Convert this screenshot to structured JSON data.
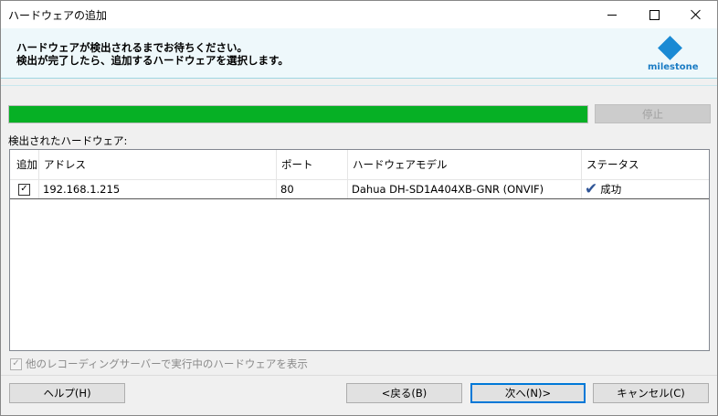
{
  "window": {
    "title": "ハードウェアの追加"
  },
  "header": {
    "line1": "ハードウェアが検出されるまでお待ちください。",
    "line2": "検出が完了したら、追加するハードウェアを選択します。",
    "logo_text": "milestone",
    "logo_color": "#1a8ad4"
  },
  "progress": {
    "percent": 100,
    "color": "#06b025",
    "stop_label": "停止"
  },
  "detected_label": "検出されたハードウェア:",
  "table": {
    "columns": {
      "add": "追加",
      "address": "アドレス",
      "port": "ポート",
      "model": "ハードウェアモデル",
      "status": "ステータス"
    },
    "rows": [
      {
        "checked": true,
        "address": "192.168.1.215",
        "port": "80",
        "model": "Dahua DH-SD1A404XB-GNR (ONVIF)",
        "status_icon": "checkmark-icon",
        "status": "成功"
      }
    ]
  },
  "show_others": {
    "label": "他のレコーディングサーバーで実行中のハードウェアを表示",
    "checked": true,
    "enabled": false
  },
  "footer": {
    "help_label": "ヘルプ(H)",
    "back_label": "<戻る(B)",
    "next_label": "次へ(N)>",
    "cancel_label": "キャンセル(C)"
  }
}
